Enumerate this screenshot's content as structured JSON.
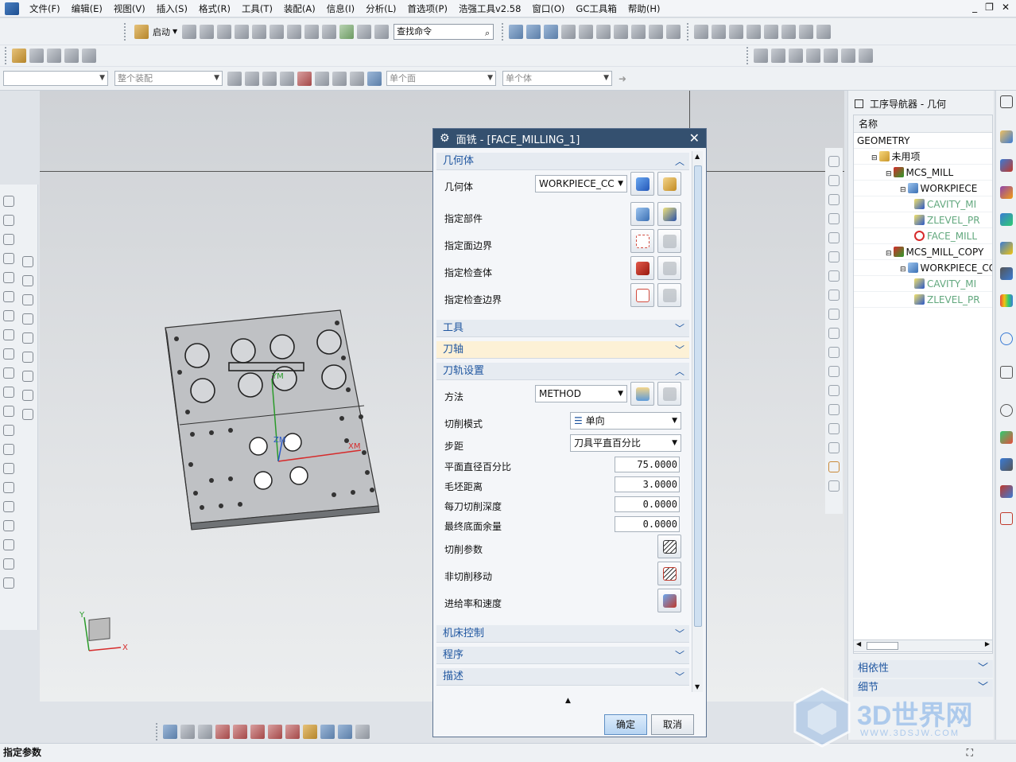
{
  "menu": {
    "items": [
      "文件(F)",
      "编辑(E)",
      "视图(V)",
      "插入(S)",
      "格式(R)",
      "工具(T)",
      "装配(A)",
      "信息(I)",
      "分析(L)",
      "首选项(P)",
      "浩强工具v2.58",
      "窗口(O)",
      "GC工具箱",
      "帮助(H)"
    ]
  },
  "toolbar": {
    "start_label": "启动",
    "search_placeholder": "查找命令",
    "filter_combo": "",
    "assembly_combo": "整个装配",
    "face_combo": "单个面",
    "body_combo": "单个体"
  },
  "viewport": {
    "axis_ym": "YM",
    "axis_zm": "ZM",
    "axis_xm": "XM",
    "triad_y": "Y",
    "triad_x": "X"
  },
  "dialog": {
    "title": "面铣 - [FACE_MILLING_1]",
    "sections": {
      "geometry": "几何体",
      "tool": "工具",
      "tool_axis": "刀轴",
      "path_settings": "刀轨设置",
      "machine_control": "机床控制",
      "program": "程序",
      "description": "描述"
    },
    "geometry": {
      "geometry_label": "几何体",
      "geometry_value": "WORKPIECE_CC",
      "part_label": "指定部件",
      "face_boundary_label": "指定面边界",
      "check_body_label": "指定检查体",
      "check_boundary_label": "指定检查边界"
    },
    "path": {
      "method_label": "方法",
      "method_value": "METHOD",
      "cut_pattern_label": "切削模式",
      "cut_pattern_value": "单向",
      "stepover_label": "步距",
      "stepover_value": "刀具平直百分比",
      "flat_diameter_label": "平面直径百分比",
      "flat_diameter_value": "75.0000",
      "blank_distance_label": "毛坯距离",
      "blank_distance_value": "3.0000",
      "depth_per_cut_label": "每刀切削深度",
      "depth_per_cut_value": "0.0000",
      "final_floor_stock_label": "最终底面余量",
      "final_floor_stock_value": "0.0000",
      "cut_params_label": "切削参数",
      "non_cut_moves_label": "非切削移动",
      "feeds_speeds_label": "进给率和速度"
    },
    "ok_label": "确定",
    "cancel_label": "取消"
  },
  "navigator": {
    "title": "工序导航器 - 几何",
    "column_name": "名称",
    "rows": [
      {
        "label": "GEOMETRY",
        "indent": 0,
        "icon": "none"
      },
      {
        "label": "未用项",
        "indent": 1,
        "icon": "folder"
      },
      {
        "label": "MCS_MILL",
        "indent": 2,
        "icon": "mcs"
      },
      {
        "label": "WORKPIECE",
        "indent": 3,
        "icon": "workpiece"
      },
      {
        "label": "CAVITY_MI",
        "indent": 4,
        "icon": "op",
        "muted": true
      },
      {
        "label": "ZLEVEL_PR",
        "indent": 4,
        "icon": "op",
        "muted": true
      },
      {
        "label": "FACE_MILL",
        "indent": 4,
        "icon": "op-error",
        "muted": true
      },
      {
        "label": "MCS_MILL_COPY",
        "indent": 2,
        "icon": "mcs"
      },
      {
        "label": "WORKPIECE_CO",
        "indent": 3,
        "icon": "workpiece"
      },
      {
        "label": "CAVITY_MI",
        "indent": 4,
        "icon": "op",
        "muted": true
      },
      {
        "label": "ZLEVEL_PR",
        "indent": 4,
        "icon": "op",
        "muted": true
      }
    ],
    "dependencies_label": "相依性",
    "details_label": "细节"
  },
  "status": {
    "prompt": "指定参数"
  },
  "watermark": {
    "brand": "3D世界网",
    "url": "WWW.3DSJW.COM"
  },
  "colors": {
    "title_bar": "#34506f",
    "section_text": "#1f56a0",
    "highlight_section": "#fdf1d6",
    "axis_x": "#d62b2b",
    "axis_y": "#2a9b2a",
    "axis_z": "#2a58c9"
  }
}
